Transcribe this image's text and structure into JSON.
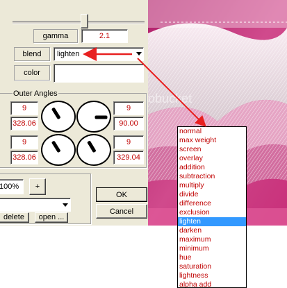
{
  "controls": {
    "gamma_label": "gamma",
    "gamma_value": "2.1",
    "blend_label": "blend",
    "blend_value": "lighten",
    "color_label": "color",
    "slider_position": 0.55
  },
  "outer_angles": {
    "title": "Outer Angles",
    "row1": {
      "left_value": "9",
      "left_angle": "328.06",
      "right_value": "9",
      "right_angle": "90.00"
    },
    "row2": {
      "left_value": "9",
      "left_angle": "328.06",
      "right_value": "9",
      "right_angle": "329.04"
    }
  },
  "zoom": {
    "value": "100%",
    "plus": "+"
  },
  "buttons": {
    "ok": "OK",
    "cancel": "Cancel",
    "delete": "delete",
    "open": "open ..."
  },
  "watermark": "photobucket",
  "blend_options": [
    "normal",
    "max weight",
    "screen",
    "overlay",
    "addition",
    "subtraction",
    "multiply",
    "divide",
    "difference",
    "exclusion",
    "lighten",
    "darken",
    "maximum",
    "minimum",
    "hue",
    "saturation",
    "lightness",
    "alpha add"
  ],
  "selected_option": "lighten",
  "colors": {
    "dialog": "#ece9d8",
    "selection": "#3399ff",
    "value_text": "#c00000",
    "arrow": "#e82020",
    "canvas_magenta": "#c8307a"
  }
}
